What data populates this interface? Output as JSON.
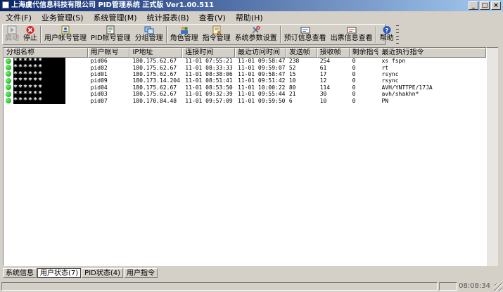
{
  "window": {
    "title": "上海虞代信息科技有限公司 PID管理系统 正式版 Ver1.00.511"
  },
  "menu": [
    "文件(F)",
    "业务管理(S)",
    "系统管理(M)",
    "统计报表(B)",
    "查看(V)",
    "帮助(H)"
  ],
  "toolbar": [
    {
      "label": "启动",
      "icon": "start-icon",
      "disabled": true
    },
    {
      "label": "停止",
      "icon": "stop-icon",
      "disabled": false
    },
    {
      "label": "用户帐号管理",
      "icon": "user-account-icon",
      "disabled": false
    },
    {
      "label": "PID帐号管理",
      "icon": "pid-account-icon",
      "disabled": false
    },
    {
      "label": "分组管理",
      "icon": "group-icon",
      "disabled": false
    },
    {
      "label": "角色管理",
      "icon": "role-icon",
      "disabled": false
    },
    {
      "label": "指令管理",
      "icon": "command-icon",
      "disabled": false
    },
    {
      "label": "系统参数设置",
      "icon": "settings-icon",
      "disabled": false
    },
    {
      "label": "预订信息查看",
      "icon": "booking-icon",
      "disabled": false
    },
    {
      "label": "出票信息查看",
      "icon": "ticket-icon",
      "disabled": false
    },
    {
      "label": "帮助",
      "icon": "help-icon",
      "disabled": false
    }
  ],
  "table": {
    "columns": [
      "分组名称",
      "用户帐号",
      "IP地址",
      "连接时间",
      "最近访问时间",
      "发送帧",
      "接收帧",
      "剩余指令",
      "最近执行指令"
    ],
    "rows": [
      {
        "group": "******",
        "user": "pid06",
        "ip": "180.175.62.67",
        "connect": "11-01 07:55:21",
        "last": "11-01 09:58:47",
        "sent": "238",
        "recv": "254",
        "remain": "0",
        "cmd": "xs fspn"
      },
      {
        "group": "******",
        "user": "pid02",
        "ip": "180.175.62.67",
        "connect": "11-01 08:33:33",
        "last": "11-01 09:59:07",
        "sent": "52",
        "recv": "61",
        "remain": "0",
        "cmd": "rt"
      },
      {
        "group": "******",
        "user": "pid01",
        "ip": "180.175.62.67",
        "connect": "11-01 08:38:06",
        "last": "11-01 09:58:47",
        "sent": "15",
        "recv": "17",
        "remain": "0",
        "cmd": "rsync"
      },
      {
        "group": "******",
        "user": "pid09",
        "ip": "180.173.14.204",
        "connect": "11-01 08:51:41",
        "last": "11-01 09:51:42",
        "sent": "10",
        "recv": "12",
        "remain": "0",
        "cmd": "rsync"
      },
      {
        "group": "******",
        "user": "pid04",
        "ip": "180.175.62.67",
        "connect": "11-01 08:53:50",
        "last": "11-01 10:00:22",
        "sent": "80",
        "recv": "114",
        "remain": "0",
        "cmd": "AVH/YNTTPE/17JA"
      },
      {
        "group": "******",
        "user": "pid03",
        "ip": "180.175.62.67",
        "connect": "11-01 09:32:39",
        "last": "11-01 09:55:44",
        "sent": "21",
        "recv": "30",
        "remain": "0",
        "cmd": "avh/shakhn*"
      },
      {
        "group": "******",
        "user": "pid07",
        "ip": "180.170.84.48",
        "connect": "11-01 09:57:09",
        "last": "11-01 09:59:50",
        "sent": "6",
        "recv": "10",
        "remain": "0",
        "cmd": "PN"
      }
    ]
  },
  "tabs": [
    {
      "label": "系统信息",
      "active": false
    },
    {
      "label": "用户状态(7)",
      "active": true
    },
    {
      "label": "PID状态(4)",
      "active": false
    },
    {
      "label": "用户指令",
      "active": false
    }
  ],
  "status": {
    "clock": "08:08:34"
  },
  "colors": {
    "online_dot": "#0a9c0a",
    "titlebar": "#0a246a",
    "face": "#d4d0c8"
  }
}
